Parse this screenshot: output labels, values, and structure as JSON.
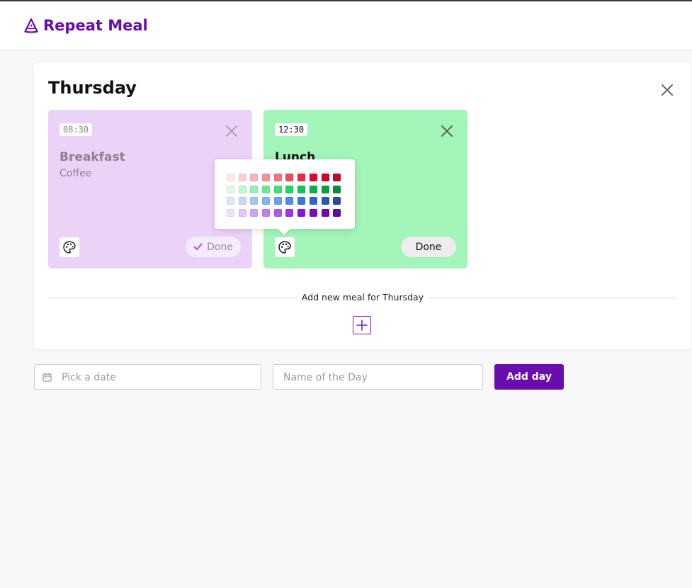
{
  "app": {
    "title": "Repeat Meal",
    "brand_color": "#6a0dad"
  },
  "day": {
    "title": "Thursday",
    "meals": [
      {
        "time": "08:30",
        "title": "Breakfast",
        "description": "Coffee",
        "done_label": "Done",
        "done": true,
        "color": "#ebd3f8"
      },
      {
        "time": "12:30",
        "title": "Lunch",
        "description": "",
        "done_label": "Done",
        "done": false,
        "color": "#a3f5b9"
      }
    ],
    "add_meal_text": "Add new meal for Thursday"
  },
  "color_picker": {
    "rows": [
      [
        "#fde8ea",
        "#fbd0d4",
        "#f8b4bb",
        "#f5949e",
        "#f27483",
        "#ef4c61",
        "#ea2a45",
        "#e0072b",
        "#d1062a",
        "#c10a29"
      ],
      [
        "#dcfbe4",
        "#bff7d0",
        "#97f0b4",
        "#6ee898",
        "#46df7c",
        "#1dd762",
        "#12c457",
        "#0dae4d",
        "#0d9c45",
        "#0a8a3d"
      ],
      [
        "#dbe8fb",
        "#c4daf8",
        "#a6c7f4",
        "#87b3f0",
        "#6a9fec",
        "#4d8be8",
        "#3c76d8",
        "#3366c2",
        "#2d58ab",
        "#284c94"
      ],
      [
        "#f0e1fb",
        "#e3c6f6",
        "#d2a3f1",
        "#c07fec",
        "#ad5be7",
        "#9b37e2",
        "#8a14dc",
        "#7b0bc6",
        "#6e0ab0",
        "#610a9b"
      ]
    ]
  },
  "form": {
    "date_placeholder": "Pick a date",
    "name_placeholder": "Name of the Day",
    "add_day_label": "Add day"
  }
}
